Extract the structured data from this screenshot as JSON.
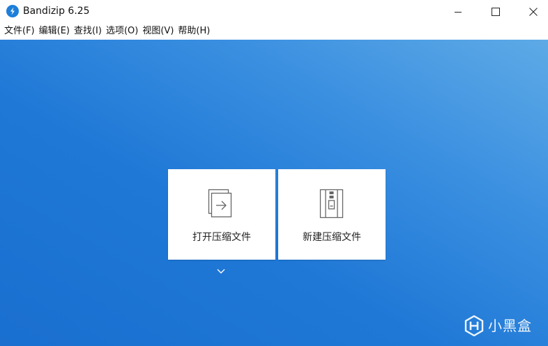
{
  "window": {
    "title": "Bandizip 6.25",
    "icon": "bandizip-logo-icon",
    "controls": [
      "minimize-icon",
      "maximize-icon",
      "close-icon"
    ]
  },
  "menu": {
    "items": [
      {
        "label": "文件(F)"
      },
      {
        "label": "编辑(E)"
      },
      {
        "label": "查找(I)"
      },
      {
        "label": "选项(O)"
      },
      {
        "label": "视图(V)"
      },
      {
        "label": "帮助(H)"
      }
    ]
  },
  "main": {
    "tiles": [
      {
        "label": "打开压缩文件",
        "icon": "open-archive-icon"
      },
      {
        "label": "新建压缩文件",
        "icon": "new-archive-icon"
      }
    ],
    "expand_icon": "chevron-down-icon"
  },
  "watermark": {
    "text": "小黑盒"
  },
  "colors": {
    "accent": "#1d7fd9",
    "background_light": "#5eaae6",
    "background_dark": "#1a6fcf",
    "tile": "#ffffff"
  }
}
